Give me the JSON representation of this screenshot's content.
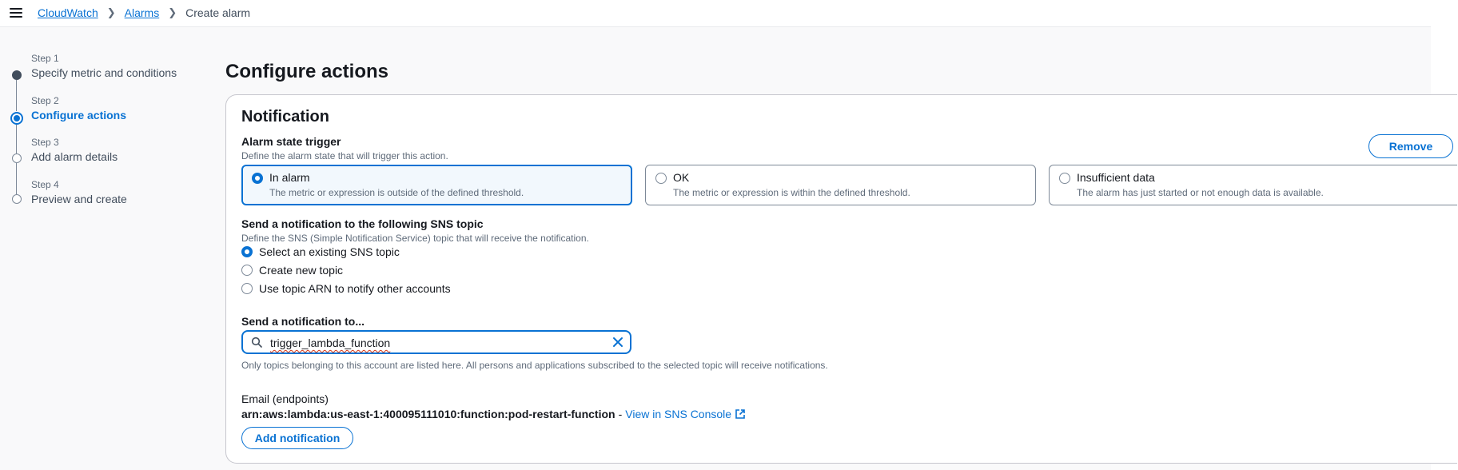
{
  "breadcrumb": {
    "items": [
      "CloudWatch",
      "Alarms"
    ],
    "current": "Create alarm"
  },
  "steps": [
    {
      "number": "Step 1",
      "label": "Specify metric and conditions",
      "state": "completed"
    },
    {
      "number": "Step 2",
      "label": "Configure actions",
      "state": "current"
    },
    {
      "number": "Step 3",
      "label": "Add alarm details",
      "state": "upcoming"
    },
    {
      "number": "Step 4",
      "label": "Preview and create",
      "state": "upcoming"
    }
  ],
  "page_title": "Configure actions",
  "notification": {
    "title": "Notification",
    "remove_label": "Remove",
    "alarm_state_trigger": {
      "label": "Alarm state trigger",
      "description": "Define the alarm state that will trigger this action.",
      "options": [
        {
          "title": "In alarm",
          "description": "The metric or expression is outside of the defined threshold.",
          "selected": true
        },
        {
          "title": "OK",
          "description": "The metric or expression is within the defined threshold.",
          "selected": false
        },
        {
          "title": "Insufficient data",
          "description": "The alarm has just started or not enough data is available.",
          "selected": false
        }
      ]
    },
    "sns_topic": {
      "label": "Send a notification to the following SNS topic",
      "description": "Define the SNS (Simple Notification Service) topic that will receive the notification.",
      "options": [
        {
          "label": "Select an existing SNS topic",
          "selected": true
        },
        {
          "label": "Create new topic",
          "selected": false
        },
        {
          "label": "Use topic ARN to notify other accounts",
          "selected": false
        }
      ]
    },
    "send_to": {
      "label": "Send a notification to...",
      "value": "trigger_lambda_function",
      "hint": "Only topics belonging to this account are listed here. All persons and applications subscribed to the selected topic will receive notifications."
    },
    "endpoints": {
      "label": "Email (endpoints)",
      "arn": "arn:aws:lambda:us-east-1:400095111010:function:pod-restart-function",
      "separator": "-",
      "link_label": "View in SNS Console"
    },
    "add_label": "Add notification"
  },
  "colors": {
    "accent": "#0972d3",
    "selected_bg": "#f2f8fd",
    "text_primary": "#16191f",
    "text_secondary": "#5f6b7a",
    "error_underline": "#d13212"
  }
}
